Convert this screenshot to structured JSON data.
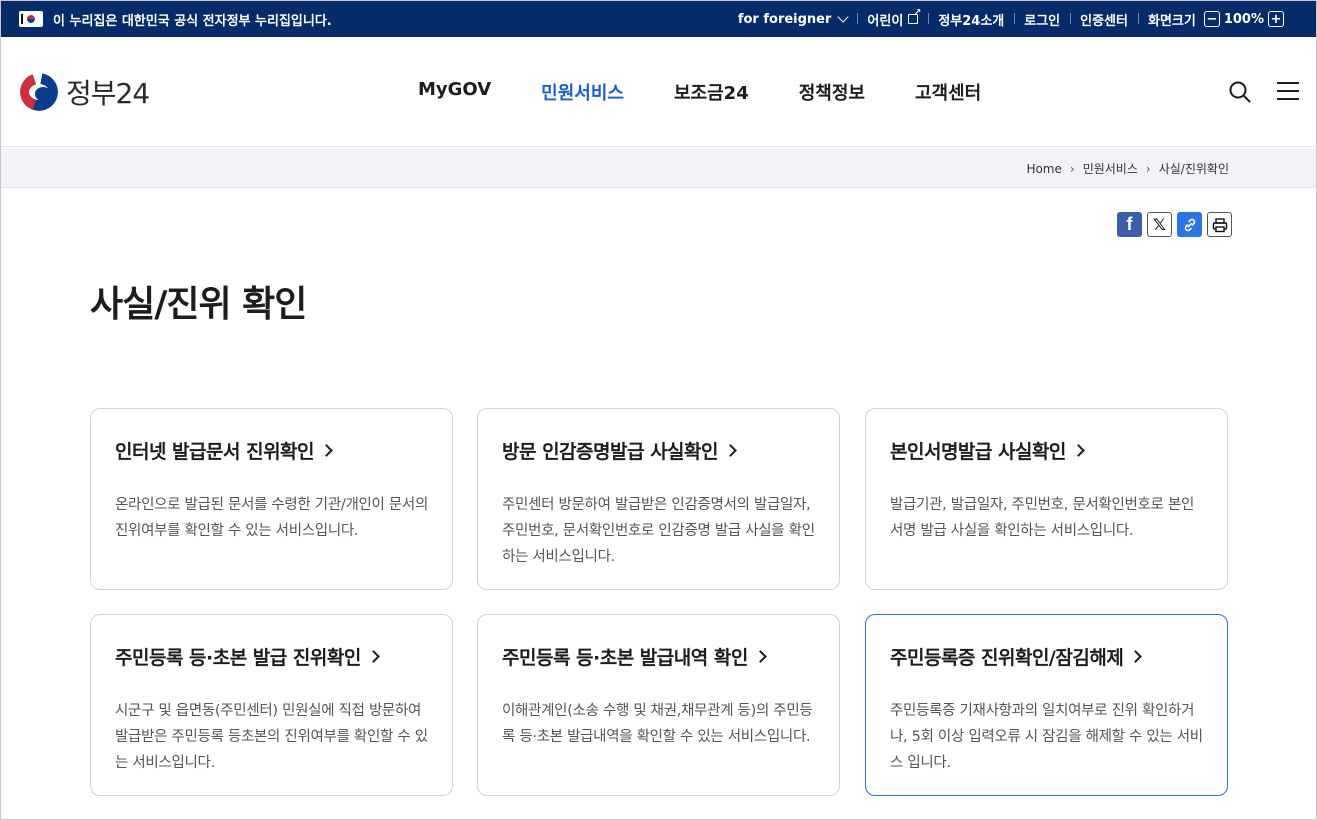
{
  "topbar": {
    "notice": "이 누리집은 대한민국 공식 전자정부 누리집입니다.",
    "links": [
      "for foreigner",
      "어린이",
      "정부24소개",
      "로그인",
      "인증센터",
      "화면크기"
    ],
    "zoom_minus": "−",
    "zoom_value": "100%",
    "zoom_plus": "+"
  },
  "header": {
    "logo_text": "정부24",
    "nav": [
      "MyGOV",
      "민원서비스",
      "보조금24",
      "정책정보",
      "고객센터"
    ],
    "active_nav": "민원서비스",
    "active_color": "#1a5fd1"
  },
  "breadcrumb": [
    "Home",
    "민원서비스",
    "사실/진위확인"
  ],
  "share": [
    "f",
    "𝕏",
    "🔗",
    "⎙"
  ],
  "page_title": "사실/진위 확인",
  "cards": [
    {
      "title": "인터넷 발급문서 진위확인",
      "desc": "온라인으로 발급된 문서를 수령한 기관/개인이 문서의 진위여부를 확인할 수 있는 서비스입니다."
    },
    {
      "title": "방문 인감증명발급 사실확인",
      "desc": "주민센터 방문하여 발급받은 인감증명서의 발급일자, 주민번호, 문서확인번호로 인감증명 발급 사실을 확인하는 서비스입니다."
    },
    {
      "title": "본인서명발급 사실확인",
      "desc": "발급기관, 발급일자, 주민번호, 문서확인번호로 본인서명 발급 사실을 확인하는 서비스입니다."
    },
    {
      "title": "주민등록 등·초본 발급 진위확인",
      "desc": "시군구 및 읍면동(주민센터) 민원실에 직접 방문하여 발급받은 주민등록 등초본의 진위여부를 확인할 수 있는 서비스입니다."
    },
    {
      "title": "주민등록 등·초본 발급내역 확인",
      "desc": "이해관계인(소송 수행 및 채권,채무관계 등)의 주민등록 등·초본 발급내역을 확인할 수 있는 서비스입니다."
    },
    {
      "title": "주민등록증 진위확인/잠김해제",
      "desc": "주민등록증 기재사항과의 일치여부로 진위 확인하거나, 5회 이상 입력오류 시 잠김을 해제할 수 있는 서비스 입니다."
    }
  ]
}
